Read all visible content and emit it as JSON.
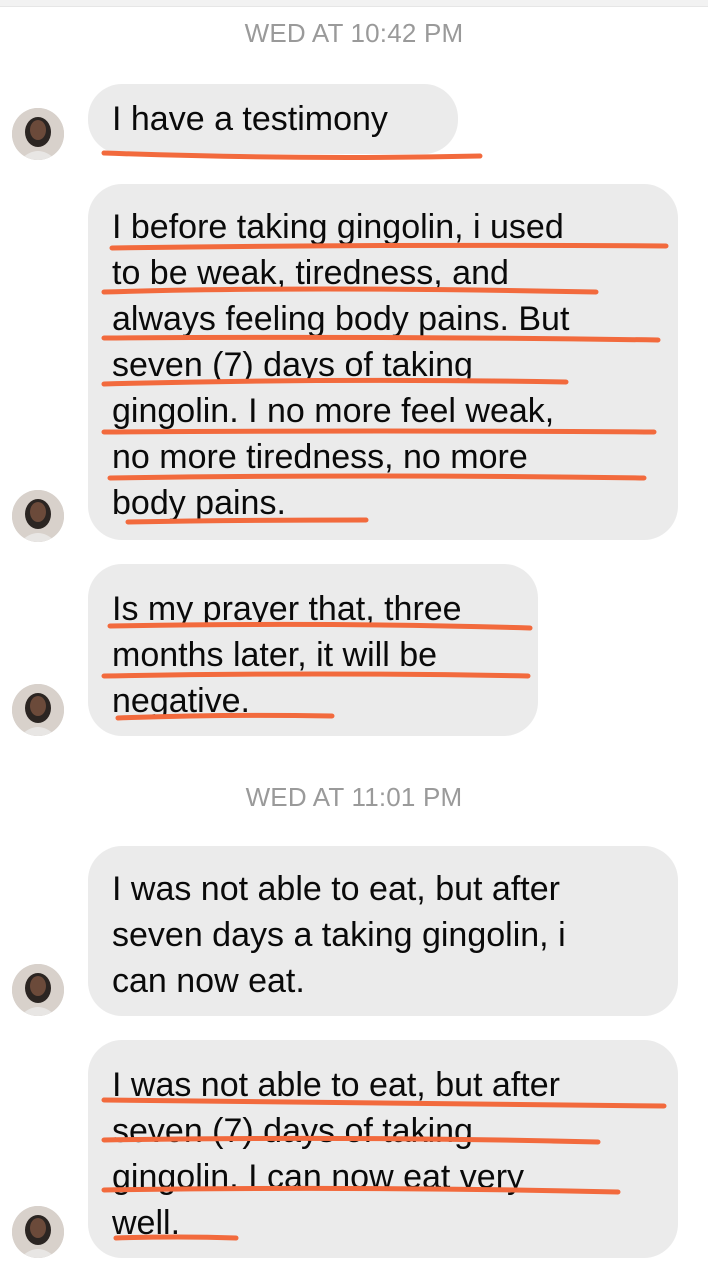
{
  "conversation": {
    "timestamps": [
      "WED AT 10:42 PM",
      "WED AT 11:01 PM"
    ],
    "messages": [
      {
        "lines": [
          "I have a testimony"
        ]
      },
      {
        "lines": [
          "I before taking gingolin, i used",
          "to be weak, tiredness, and",
          "always feeling body pains. But",
          "seven (7) days of taking",
          "gingolin. I no more feel weak,",
          "no more tiredness, no more",
          "body pains."
        ]
      },
      {
        "lines": [
          "Is my prayer that, three",
          "months later, it will be",
          "negative."
        ]
      },
      {
        "lines": [
          "I was not able to eat, but after",
          "seven days a taking gingolin, i",
          "can now eat."
        ]
      },
      {
        "lines": [
          "I was not able to eat, but after",
          "seven (7) days of taking",
          "gingolin. I can now eat very",
          "well."
        ]
      }
    ]
  },
  "colors": {
    "bubble_bg": "#ebebeb",
    "timestamp_text": "#9a9a9a",
    "underline": "#f26a3d"
  },
  "icons": {
    "avatar": "profile-photo-avatar"
  }
}
